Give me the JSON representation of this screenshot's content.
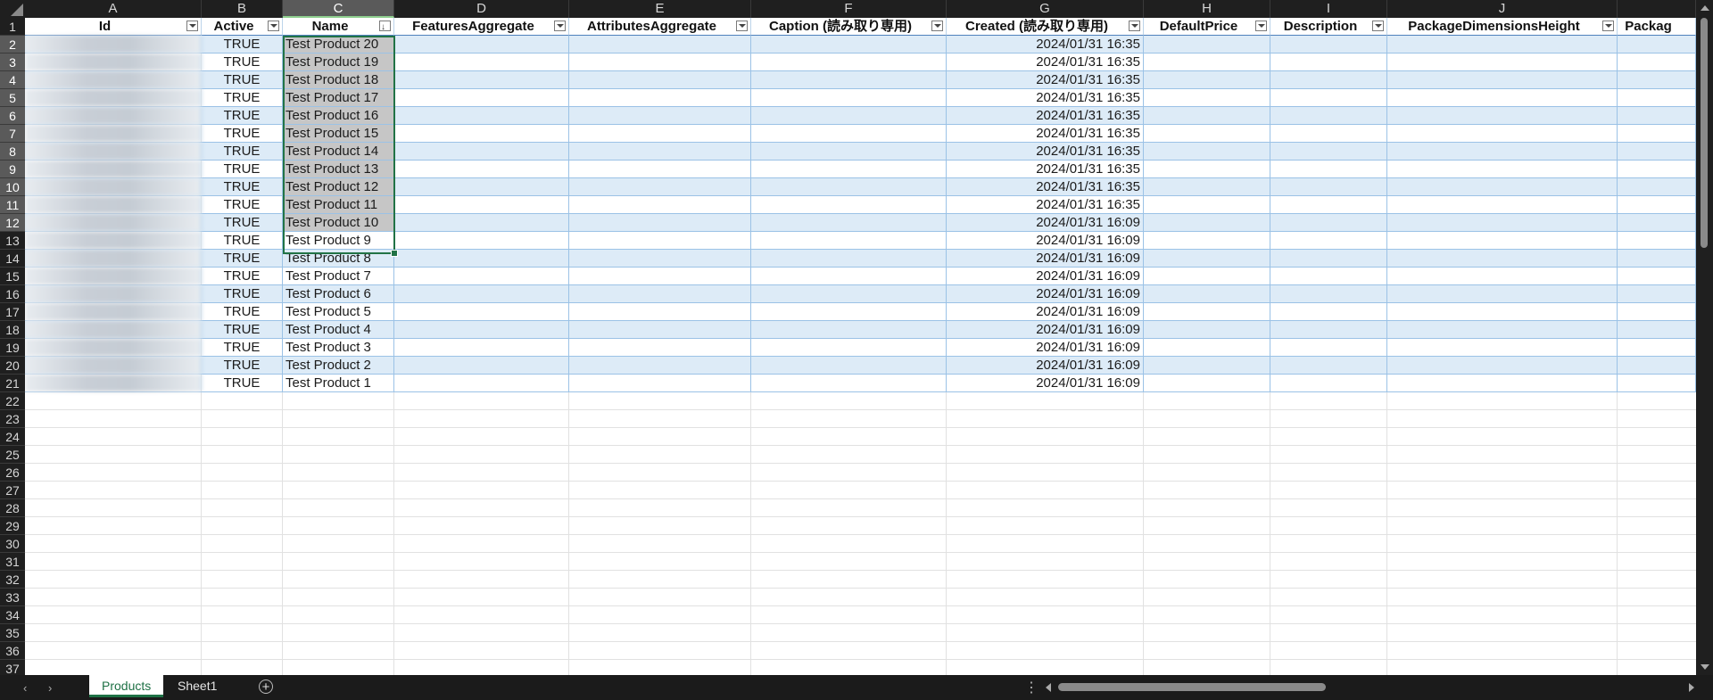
{
  "columns": [
    "A",
    "B",
    "C",
    "D",
    "E",
    "F",
    "G",
    "H",
    "I",
    "J",
    ""
  ],
  "selected_column": "C",
  "headers": [
    "Id",
    "Active",
    "Name",
    "FeaturesAggregate",
    "AttributesAggregate",
    "Caption (読み取り専用)",
    "Created (読み取り専用)",
    "DefaultPrice",
    "Description",
    "PackageDimensionsHeight",
    "Packag"
  ],
  "sorted_header": "Name",
  "rows": [
    {
      "active": "TRUE",
      "name": "Test Product 20",
      "created": "2024/01/31 16:35"
    },
    {
      "active": "TRUE",
      "name": "Test Product 19",
      "created": "2024/01/31 16:35"
    },
    {
      "active": "TRUE",
      "name": "Test Product 18",
      "created": "2024/01/31 16:35"
    },
    {
      "active": "TRUE",
      "name": "Test Product 17",
      "created": "2024/01/31 16:35"
    },
    {
      "active": "TRUE",
      "name": "Test Product 16",
      "created": "2024/01/31 16:35"
    },
    {
      "active": "TRUE",
      "name": "Test Product 15",
      "created": "2024/01/31 16:35"
    },
    {
      "active": "TRUE",
      "name": "Test Product 14",
      "created": "2024/01/31 16:35"
    },
    {
      "active": "TRUE",
      "name": "Test Product 13",
      "created": "2024/01/31 16:35"
    },
    {
      "active": "TRUE",
      "name": "Test Product 12",
      "created": "2024/01/31 16:35"
    },
    {
      "active": "TRUE",
      "name": "Test Product 11",
      "created": "2024/01/31 16:35"
    },
    {
      "active": "TRUE",
      "name": "Test Product 10",
      "created": "2024/01/31 16:09"
    },
    {
      "active": "TRUE",
      "name": "Test Product 9",
      "created": "2024/01/31 16:09"
    },
    {
      "active": "TRUE",
      "name": "Test Product 8",
      "created": "2024/01/31 16:09"
    },
    {
      "active": "TRUE",
      "name": "Test Product 7",
      "created": "2024/01/31 16:09"
    },
    {
      "active": "TRUE",
      "name": "Test Product 6",
      "created": "2024/01/31 16:09"
    },
    {
      "active": "TRUE",
      "name": "Test Product 5",
      "created": "2024/01/31 16:09"
    },
    {
      "active": "TRUE",
      "name": "Test Product 4",
      "created": "2024/01/31 16:09"
    },
    {
      "active": "TRUE",
      "name": "Test Product 3",
      "created": "2024/01/31 16:09"
    },
    {
      "active": "TRUE",
      "name": "Test Product 2",
      "created": "2024/01/31 16:09"
    },
    {
      "active": "TRUE",
      "name": "Test Product 1",
      "created": "2024/01/31 16:09"
    }
  ],
  "selected_rows": [
    "2",
    "3",
    "4",
    "5",
    "6",
    "7",
    "8",
    "9",
    "10",
    "11",
    "12"
  ],
  "row_numbers": [
    "1",
    "2",
    "3",
    "4",
    "5",
    "6",
    "7",
    "8",
    "9",
    "10",
    "11",
    "12",
    "13",
    "14",
    "15",
    "16",
    "17",
    "18",
    "19",
    "20",
    "21",
    "22",
    "23",
    "24",
    "25",
    "26",
    "27",
    "28",
    "29",
    "30",
    "31",
    "32",
    "33",
    "34",
    "35",
    "36",
    "37"
  ],
  "sheet_tabs": [
    {
      "label": "Products",
      "active": true
    },
    {
      "label": "Sheet1",
      "active": false
    }
  ],
  "colors": {
    "table_header_border": "#4f81bd",
    "band": "#ddebf7",
    "row_border": "#9bc2e6",
    "selection": "#217346",
    "active_tab": "#1e7145"
  }
}
